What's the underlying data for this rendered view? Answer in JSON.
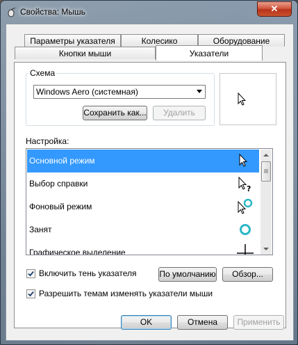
{
  "window": {
    "title": "Свойства: Мышь",
    "close_label": "✕"
  },
  "tabs": {
    "top": [
      "Параметры указателя",
      "Колесико",
      "Оборудование"
    ],
    "bottom": [
      "Кнопки мыши",
      "Указатели"
    ],
    "active": "Указатели"
  },
  "scheme": {
    "group_label": "Схема",
    "selected": "Windows Aero (системная)",
    "save_label": "Сохранить как...",
    "delete_label": "Удалить"
  },
  "customize": {
    "label": "Настройка:",
    "items": [
      {
        "label": "Основной режим",
        "icon": "arrow-cursor-icon",
        "selected": true
      },
      {
        "label": "Выбор справки",
        "icon": "help-cursor-icon",
        "selected": false
      },
      {
        "label": "Фоновый режим",
        "icon": "working-in-background-cursor-icon",
        "selected": false
      },
      {
        "label": "Занят",
        "icon": "busy-cursor-icon",
        "selected": false
      },
      {
        "label": "Графическое выделение",
        "icon": "precision-select-cursor-icon",
        "selected": false
      }
    ]
  },
  "options": {
    "shadow_label": "Включить тень указателя",
    "shadow_checked": true,
    "themes_label": "Разрешить темам изменять указатели мыши",
    "themes_checked": true,
    "default_label": "По умолчанию",
    "browse_label": "Обзор..."
  },
  "footer": {
    "ok": "OK",
    "cancel": "Отмена",
    "apply": "Применить"
  },
  "colors": {
    "selection": "#3399ff",
    "close": "#c9432a",
    "busy_ring": "#2bb7c6"
  }
}
